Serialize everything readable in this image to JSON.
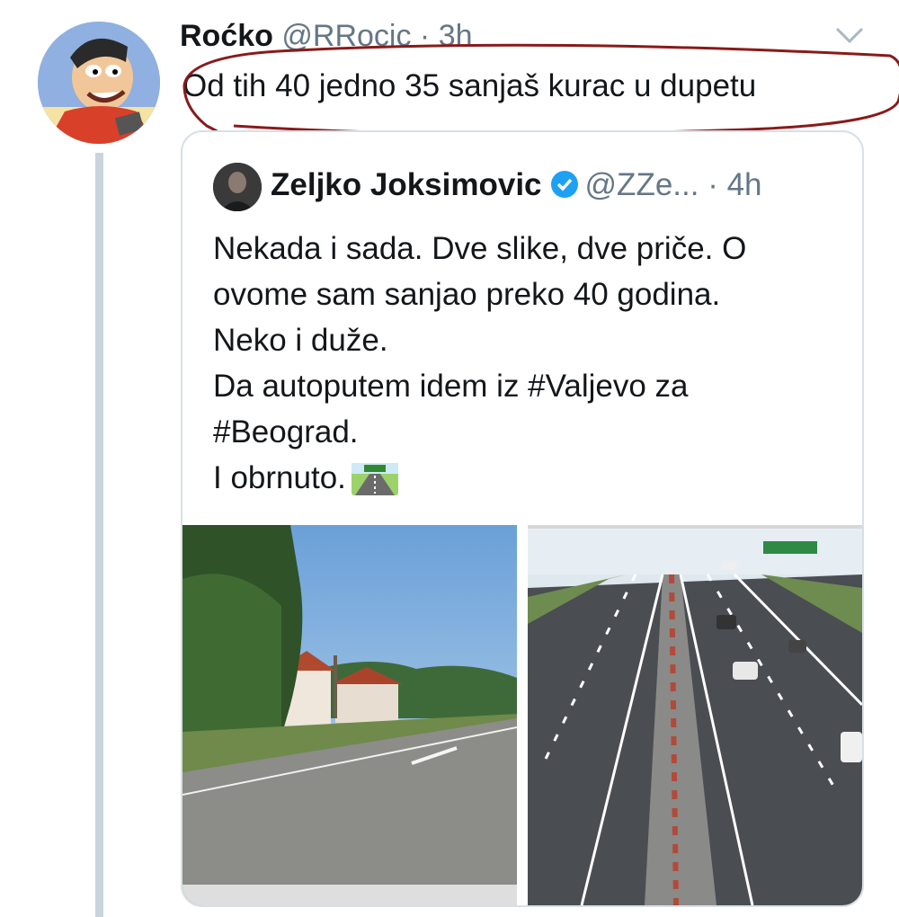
{
  "tweet": {
    "name": "Roćko",
    "handle": "@RRocic",
    "time": "3h",
    "separator": " · ",
    "text": "Od tih 40 jedno 35 sanjaš kurac u dupetu",
    "avatar_icon": "cartoon-avatar-icon",
    "menu_icon": "chevron-down-icon"
  },
  "quote": {
    "name": "Zeljko Joksimovic",
    "handle": "@ZZe...",
    "time": "4h",
    "separator": " · ",
    "lines": [
      "Nekada i sada. Dve slike, dve priče. O",
      "ovome sam sanjao preko 40 godina.",
      "Neko i duže.",
      "Da autoputem idem iz #Valjevo za",
      "#Beograd.",
      "I obrnuto."
    ],
    "emoji": "motorway-emoji",
    "verified_icon": "verified-badge-icon",
    "photos": [
      "rural-road-photo",
      "highway-photo"
    ]
  },
  "colors": {
    "text": "#14171a",
    "muted": "#657786",
    "border": "#d8e0e6",
    "verified": "#1da1f2",
    "annotation": "#8a1a1a"
  }
}
